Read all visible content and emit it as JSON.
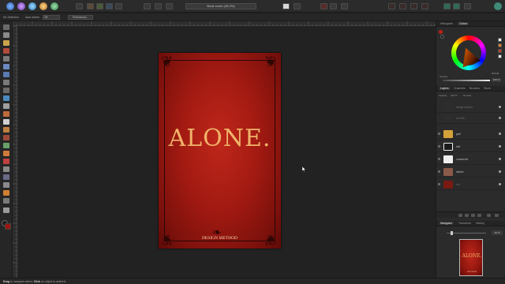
{
  "app": {
    "document_title": "Book cover (26.2%)"
  },
  "context_toolbar": {
    "no_selection": "No Selection",
    "auto_select_label": "Auto-select:",
    "auto_select_value": "Off",
    "preferences_button": "Preferences..."
  },
  "canvas": {
    "cover_title": "ALONE.",
    "cover_footer": "DESIGN METHOD"
  },
  "status_bar": {
    "key1": "Drag",
    "text1": " to marquee select. ",
    "key2": "Click",
    "text2": " an object to select it."
  },
  "colour_panel": {
    "tabs": [
      "Histogram",
      "Colour"
    ],
    "active_tab": "Colour",
    "hex_label": "Bfc6d8",
    "opacity_label": "Opacity",
    "opacity_value": "100 %",
    "accent": "#c11f12"
  },
  "layers_panel": {
    "tabs": [
      "Layers",
      "Channels",
      "Brushes",
      "Stock"
    ],
    "opacity_label": "Opacity:",
    "opacity_value": "100 %",
    "blend_mode": "Normal",
    "layers": [
      {
        "name": "design method",
        "dim": true
      },
      {
        "name": "ALONE.",
        "dim": true
      },
      {
        "name": "gold",
        "dim": false
      },
      {
        "name": "leaf",
        "dim": false
      },
      {
        "name": "ornaments",
        "dim": false
      },
      {
        "name": "leather",
        "dim": false
      },
      {
        "name": "red",
        "dim": true
      }
    ]
  },
  "navigator_panel": {
    "tabs": [
      "Navigator",
      "Transform",
      "History"
    ],
    "zoom_value": "26 %"
  }
}
